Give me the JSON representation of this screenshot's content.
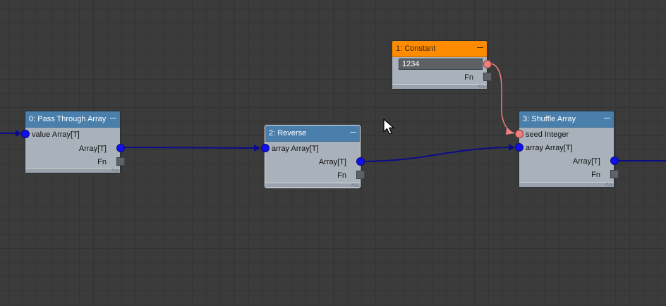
{
  "nodes": {
    "pass_through": {
      "title": "0: Pass Through Array",
      "input_label": "value Array[T]",
      "output_label": "Array[T]",
      "fn_label": "Fn"
    },
    "reverse": {
      "title": "2: Reverse",
      "input_label": "array Array[T]",
      "output_label": "Array[T]",
      "fn_label": "Fn"
    },
    "constant": {
      "title": "1: Constant",
      "value": "1234",
      "fn_label": "Fn"
    },
    "shuffle": {
      "title": "3: Shuffle Array",
      "seed_label": "seed Integer",
      "input_label": "array Array[T]",
      "output_label": "Array[T]",
      "fn_label": "Fn"
    }
  },
  "colors": {
    "canvas": "#3b3b3b",
    "node_body": "#a9b2bb",
    "node_header": "#4a7eab",
    "constant_header": "#ff8c00",
    "array_wire": "#0b0b8a",
    "array_port": "#1010ee",
    "integer_wire": "#f08080",
    "integer_port": "#f08080"
  },
  "icons": {
    "collapse": "minus-icon",
    "cursor": "mouse-pointer-icon"
  }
}
